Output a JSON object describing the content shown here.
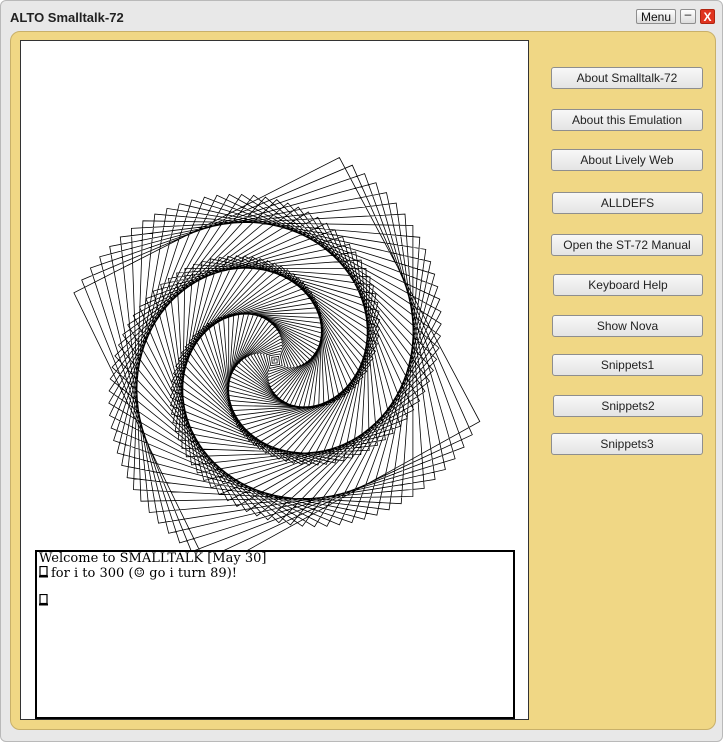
{
  "window": {
    "title": "ALTO Smalltalk-72",
    "menu_label": "Menu",
    "minimize_label": "–",
    "close_label": "X"
  },
  "transcript": {
    "line1": "Welcome to SMALLTALK [May 30]",
    "line2": "for i to 300 (☺ go i turn 89)!",
    "line3": ""
  },
  "spiral": {
    "steps": 300,
    "turn_degrees": 89
  },
  "buttons": [
    {
      "label": "About Smalltalk-72"
    },
    {
      "label": "About this Emulation"
    },
    {
      "label": "About Lively Web"
    },
    {
      "label": "ALLDEFS"
    },
    {
      "label": "Open the ST-72 Manual"
    },
    {
      "label": "Keyboard Help"
    },
    {
      "label": "Show Nova"
    },
    {
      "label": "Snippets1"
    },
    {
      "label": "Snippets2"
    },
    {
      "label": "Snippets3"
    }
  ],
  "colors": {
    "panel": "#f0d785",
    "close": "#e0341f"
  }
}
